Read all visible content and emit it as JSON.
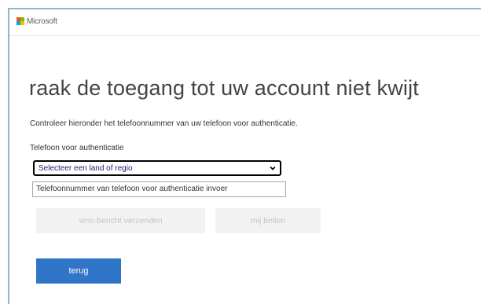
{
  "header": {
    "brand": "Microsoft"
  },
  "page": {
    "title": "raak de toegang tot uw account niet kwijt",
    "description": "Controleer hieronder het telefoonnummer van uw telefoon voor authenticatie."
  },
  "form": {
    "phone_label": "Telefoon voor authenticatie",
    "country_select_value": "Selecteer een land of regio",
    "phone_placeholder": "Telefoonnummer van telefoon voor authenticatie invoer"
  },
  "buttons": {
    "sms": "sms-bericht verzenden",
    "call": "mij bellen",
    "back": "terug"
  },
  "colors": {
    "accent": "#2f75c8",
    "disabled_bg": "#f2f2f2",
    "disabled_text": "#c4c4c4"
  },
  "icons": {
    "logo": "microsoft-logo-icon",
    "select": "chevron-down-icon"
  }
}
